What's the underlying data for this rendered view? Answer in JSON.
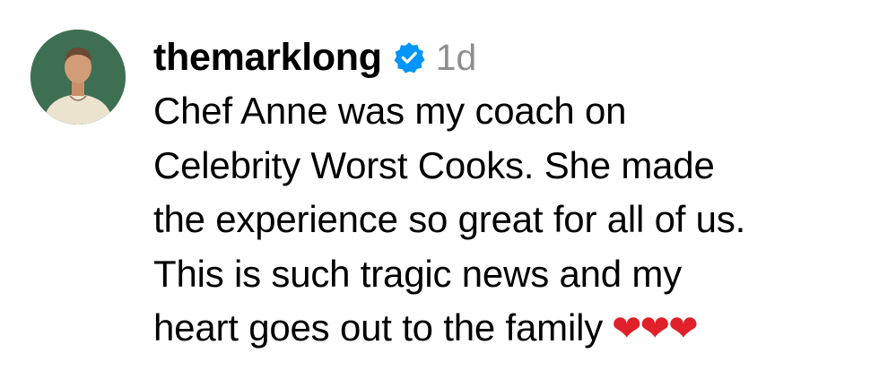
{
  "comment": {
    "username": "themarklong",
    "verified_icon": "verified-badge-icon",
    "timestamp": "1d",
    "text_lines": [
      "Chef Anne was my coach on",
      "Celebrity Worst Cooks. She made",
      "the experience so great for all of us.",
      "This is such tragic news and my",
      "heart goes out to the family"
    ],
    "emoji": "❤❤❤",
    "colors": {
      "verified_blue": "#0095f6",
      "timestamp_gray": "#8e8e8e",
      "heart_red": "#e0202a"
    }
  }
}
